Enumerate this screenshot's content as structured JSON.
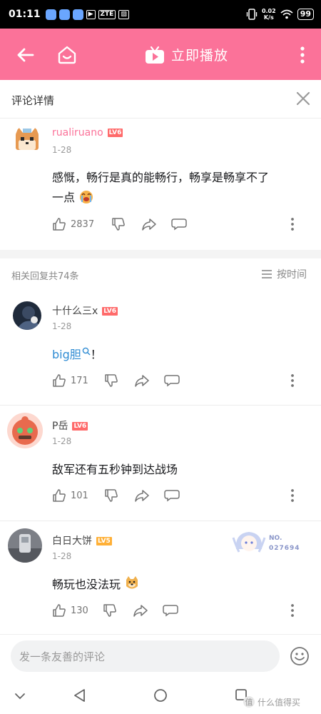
{
  "status_bar": {
    "time": "01:11",
    "carrier_tag": "ZTE",
    "speed_value": "0.02",
    "speed_unit": "K/s",
    "battery": "99"
  },
  "top_bar": {
    "play_label": "立即播放"
  },
  "header": {
    "title": "评论详情"
  },
  "main_comment": {
    "username": "rualiruano",
    "level": "LV6",
    "date": "1-28",
    "text_line1": "感慨，畅行是真的能畅行，畅享是畅享不了",
    "text_line2": "一点",
    "likes": "2837"
  },
  "replies_bar": {
    "count_text": "相关回复共74条",
    "sort_label": "按时间"
  },
  "replies": [
    {
      "username": "十什么三x",
      "level": "LV6",
      "date": "1-28",
      "text": "big胆",
      "text_suffix": "！",
      "likes": "171"
    },
    {
      "username": "P岳",
      "level": "LV6",
      "date": "1-28",
      "text": "敌军还有五秒钟到达战场",
      "likes": "101"
    },
    {
      "username": "白日大饼",
      "level": "LV5",
      "date": "1-28",
      "text": "畅玩也没法玩",
      "likes": "130",
      "badge_label": "NO.",
      "badge_number": "027694"
    }
  ],
  "input": {
    "placeholder": "发一条友善的评论"
  },
  "watermark": {
    "text": "什么值得买"
  },
  "colors": {
    "brand_pink": "#fb7299",
    "lv6": "#ff6b6b",
    "lv5": "#ffb037",
    "link": "#2e8bd3"
  },
  "icons": [
    "back-arrow-icon",
    "home-tv-icon",
    "tv-play-icon",
    "more-vertical-icon",
    "close-icon",
    "thumb-up-icon",
    "thumb-down-icon",
    "share-icon",
    "comment-bubble-icon",
    "sort-list-icon",
    "emoji-icon",
    "search-icon",
    "back-triangle-icon",
    "home-circle-icon",
    "recents-square-icon",
    "chevron-down-icon"
  ]
}
